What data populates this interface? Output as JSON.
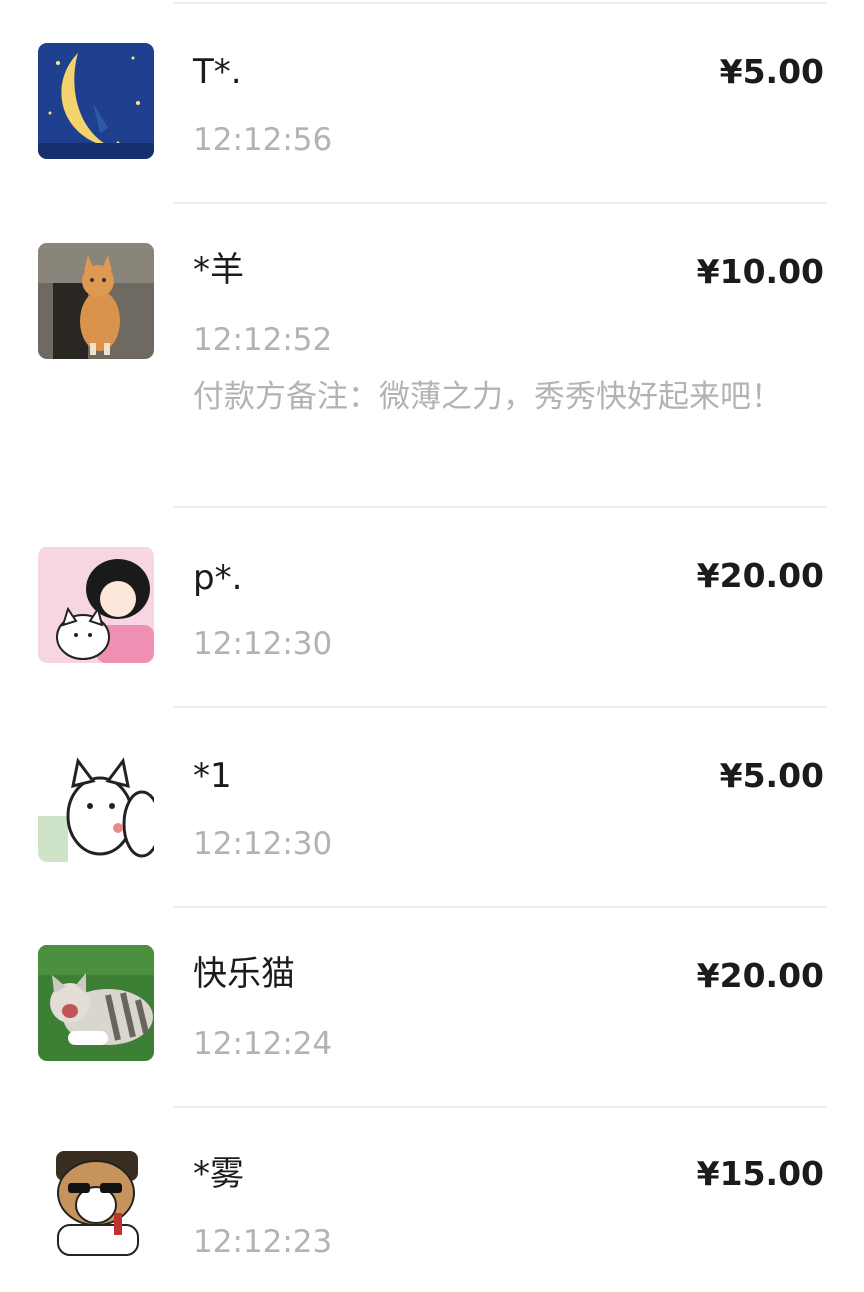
{
  "payments": [
    {
      "name": "T*.",
      "amount": "¥5.00",
      "time": "12:12:56",
      "note": "",
      "avatar": "crescent-moon-avatar"
    },
    {
      "name": "*羊",
      "amount": "¥10.00",
      "time": "12:12:52",
      "note": "付款方备注：微薄之力，秀秀快好起来吧！",
      "avatar": "orange-cat-avatar"
    },
    {
      "name": "p*.",
      "amount": "¥20.00",
      "time": "12:12:30",
      "note": "",
      "avatar": "girl-with-cat-avatar"
    },
    {
      "name": "*1",
      "amount": "¥5.00",
      "time": "12:12:30",
      "note": "",
      "avatar": "white-cats-avatar"
    },
    {
      "name": "快乐猫",
      "amount": "¥20.00",
      "time": "12:12:24",
      "note": "",
      "avatar": "yawning-cat-avatar"
    },
    {
      "name": "*雾",
      "amount": "¥15.00",
      "time": "12:12:23",
      "note": "",
      "avatar": "cool-dog-avatar"
    }
  ],
  "colors": {
    "primary_text": "#1b1b1b",
    "secondary_text": "#b3b3b3",
    "divider": "#ececec"
  }
}
